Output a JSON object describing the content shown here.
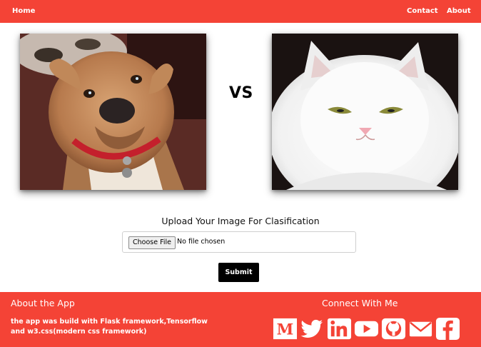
{
  "nav": {
    "home": "Home",
    "contact": "Contact",
    "about": "About"
  },
  "compare": {
    "vs": "VS",
    "left_image": "dog-photo",
    "right_image": "cat-photo"
  },
  "upload": {
    "title": "Upload Your Image For Clasification",
    "choose_label": "Choose File",
    "status": "No file chosen",
    "submit": "Submit"
  },
  "footer": {
    "about_title": "About the App",
    "about_text": "the app was build with Flask framework,Tensorflow and w3.css(modern css framework)",
    "connect_title": "Connect With Me",
    "social_icons": [
      "medium-icon",
      "twitter-icon",
      "linkedin-icon",
      "youtube-icon",
      "github-icon",
      "email-icon",
      "facebook-icon"
    ]
  },
  "colors": {
    "accent": "#f44336",
    "button": "#000000"
  }
}
